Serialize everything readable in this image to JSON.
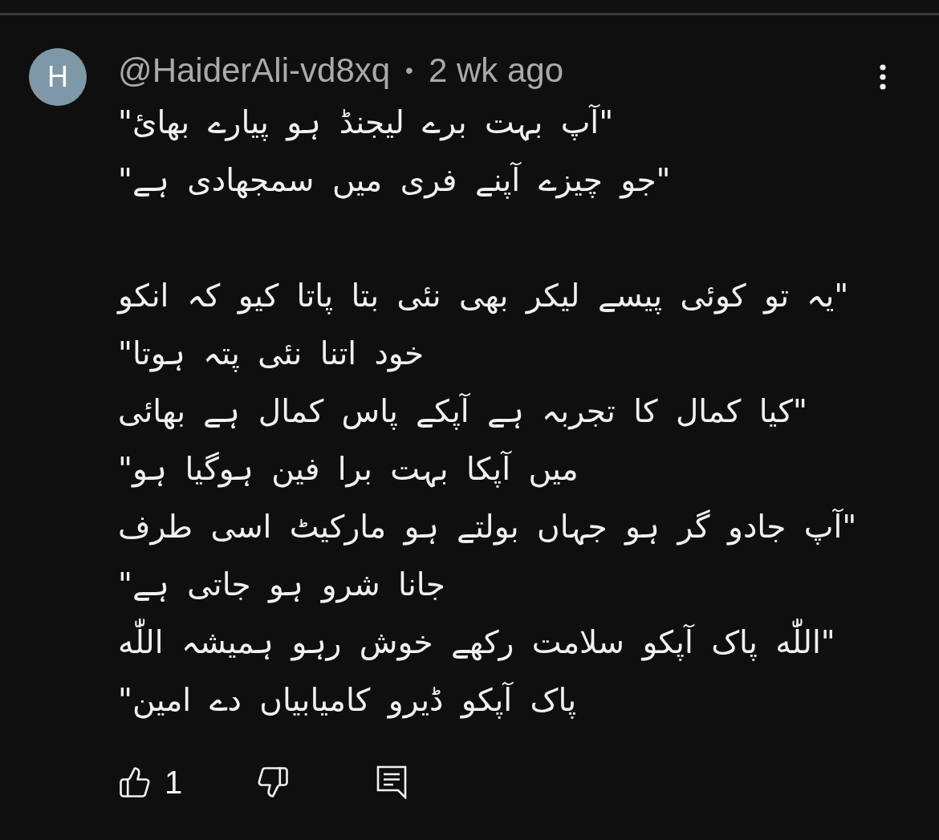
{
  "comment": {
    "avatar_letter": "H",
    "author": "@HaiderAli-vd8xq",
    "separator": "•",
    "time": "2 wk ago",
    "text": "\"آپ بہت برے لیجنڈ ہو پیارے بھائ\"\n\"جو چیزے آپنے فری میں سمجھادی ہے\"\n\n\"یہ تو کوئی پیسے لیکر بھی نئی بتا پاتا کیو کہ انکو خود اتنا نئی پتہ ہوتا\"\n\"کیا کمال کا تجربہ ہے آپکے پاس کمال ہے بھائی میں آپکا بہت برا فین ہوگیا ہو\"\n\"آپ جادو گر ہو جہاں بولتے ہو مارکیٹ اسی طرف جانا شرو ہو جاتی ہے\"\n\"اللّٰه پاک آپکو سلامت رکھے خوش رہو ہمیشہ اللّٰه پاک آپکو ڈیرو کامیابیاں دے امین\"",
    "likes": "1"
  }
}
